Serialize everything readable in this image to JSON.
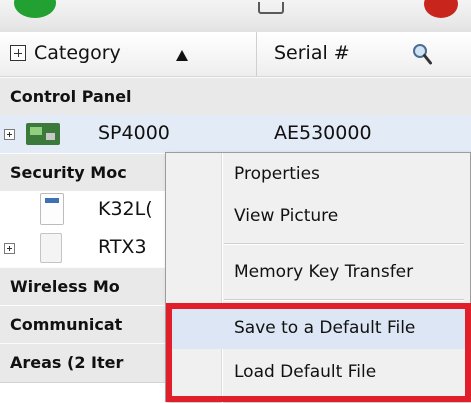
{
  "header": {
    "category_label": "Category",
    "serial_label": "Serial #"
  },
  "groups": {
    "control_panel": "Control Panel",
    "security_modules": "Security Moc",
    "wireless_modules": "Wireless Mo",
    "communication": "Communicat",
    "areas": "Areas (2 Iter"
  },
  "items": {
    "sp4000_name": "SP4000",
    "sp4000_serial": "AE530000",
    "k32lcd_name": "K32L(",
    "rtx3_name": "RTX3"
  },
  "context_menu": {
    "properties": "Properties",
    "view_picture": "View Picture",
    "memory_key_transfer": "Memory Key Transfer",
    "save_default": "Save to a Default File",
    "load_default": "Load Default File"
  },
  "colors": {
    "highlight": "#e01f2a",
    "menu_hover": "#dde6f4",
    "row_selected": "#e3ebf6"
  }
}
